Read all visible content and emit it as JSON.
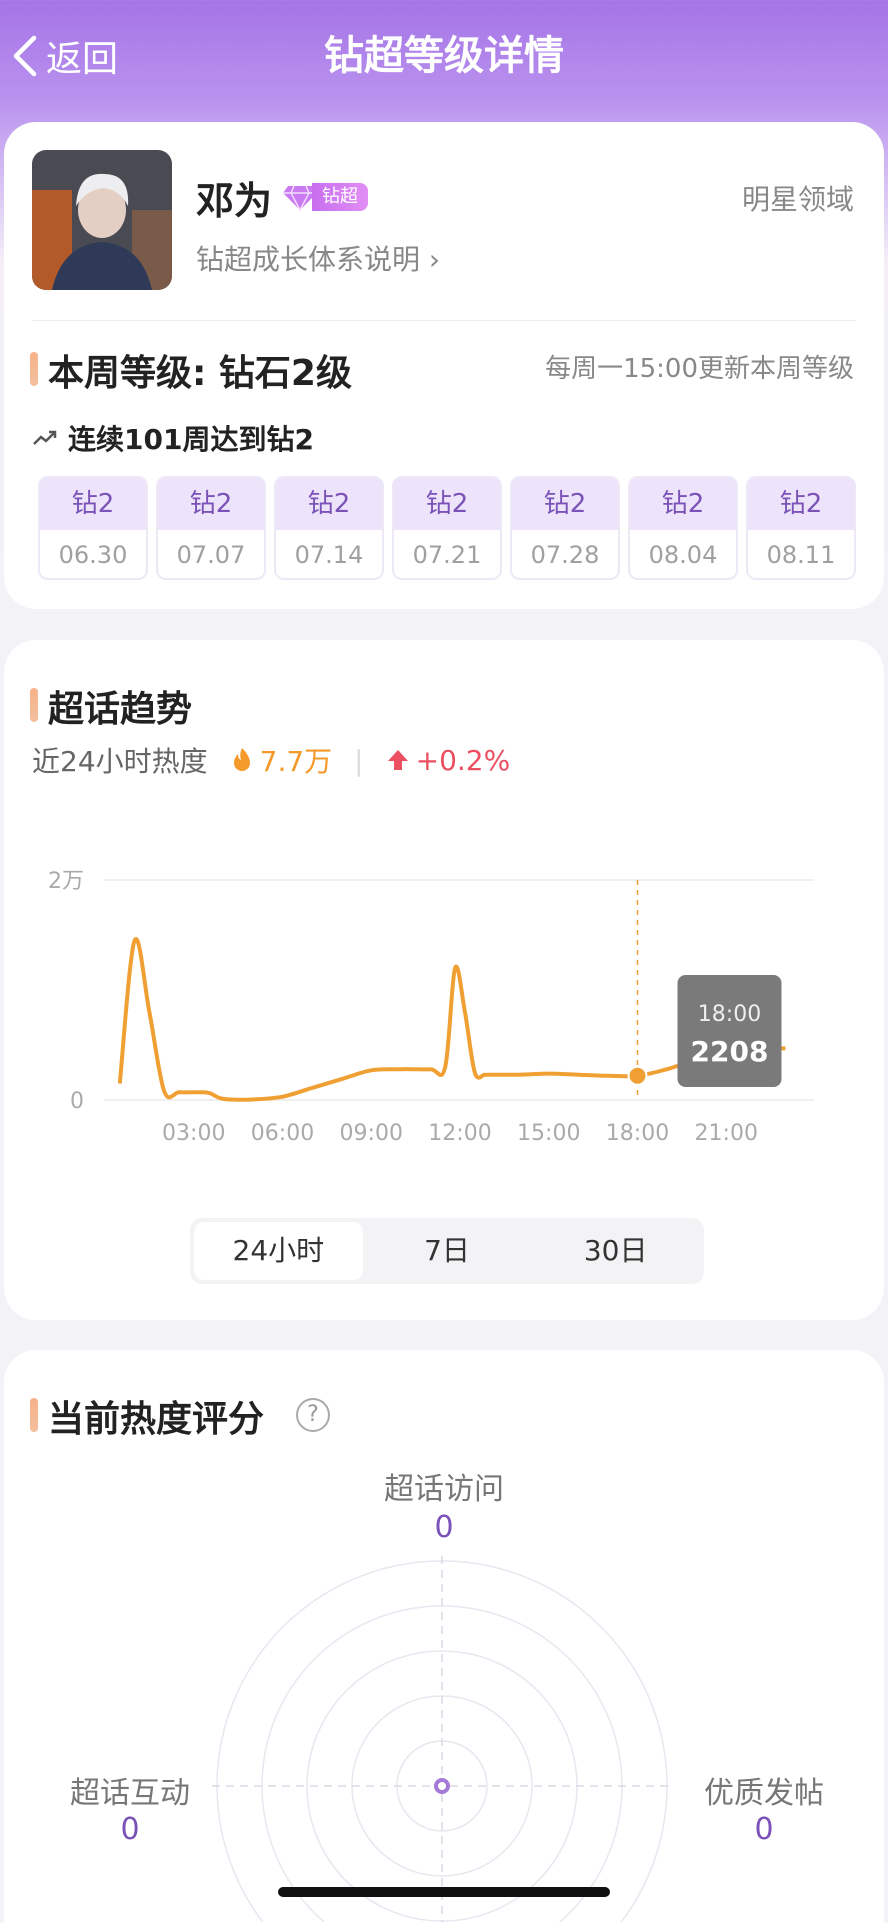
{
  "header": {
    "back_label": "返回",
    "title": "钻超等级详情"
  },
  "profile": {
    "name": "邓为",
    "badge_text": "钻超",
    "intro_link": "钻超成长体系说明 ›",
    "domain": "明星领域"
  },
  "level": {
    "title": "本周等级: 钻石2级",
    "update_note": "每周一15:00更新本周等级",
    "streak": "连续101周达到钻2",
    "weeks": [
      {
        "level": "钻2",
        "date": "06.30"
      },
      {
        "level": "钻2",
        "date": "07.07"
      },
      {
        "level": "钻2",
        "date": "07.14"
      },
      {
        "level": "钻2",
        "date": "07.21"
      },
      {
        "level": "钻2",
        "date": "07.28"
      },
      {
        "level": "钻2",
        "date": "08.04"
      },
      {
        "level": "钻2",
        "date": "08.11"
      }
    ]
  },
  "trend": {
    "title": "超话趋势",
    "label": "近24小时热度",
    "heat": "7.7万",
    "change": "+0.2%",
    "tabs": [
      "24小时",
      "7日",
      "30日"
    ],
    "active_tab": 0
  },
  "chart_data": {
    "type": "line",
    "x": [
      "00:30",
      "01:00",
      "01:30",
      "02:00",
      "02:30",
      "03:00",
      "03:30",
      "04:00",
      "05:00",
      "06:00",
      "07:00",
      "08:00",
      "09:00",
      "10:00",
      "11:00",
      "11:30",
      "11:50",
      "12:10",
      "12:30",
      "12:50",
      "13:00",
      "14:00",
      "15:00",
      "16:00",
      "17:00",
      "18:00",
      "19:00",
      "20:00",
      "21:00",
      "22:00",
      "23:00"
    ],
    "values": [
      1500,
      14500,
      8000,
      800,
      700,
      700,
      650,
      100,
      50,
      300,
      1100,
      1900,
      2700,
      2800,
      2800,
      3000,
      12000,
      8000,
      2500,
      2300,
      2300,
      2300,
      2400,
      2300,
      2200,
      2200,
      2800,
      3600,
      3600,
      4600,
      4700
    ],
    "x_ticks": [
      "03:00",
      "06:00",
      "09:00",
      "12:00",
      "15:00",
      "18:00",
      "21:00"
    ],
    "y_ticks": [
      "0",
      "2万"
    ],
    "ylim": [
      0,
      20000
    ],
    "color": "#f0a033",
    "tooltip": {
      "time": "18:00",
      "value": "2208"
    }
  },
  "score": {
    "title": "当前热度评分",
    "help": "?",
    "axes": [
      {
        "label": "超话访问",
        "value": "0"
      },
      {
        "label": "超话互动",
        "value": "0"
      },
      {
        "label": "优质发帖",
        "value": "0"
      }
    ]
  }
}
